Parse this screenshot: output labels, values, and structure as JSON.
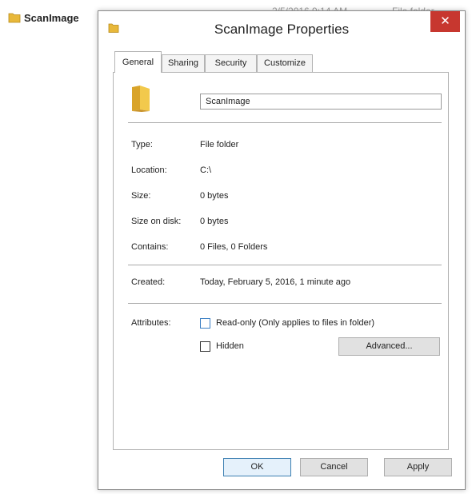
{
  "background": {
    "folder_name": "ScanImage",
    "date_fragment": "2/5/2016 9:14 AM",
    "type_fragment": "File folder"
  },
  "dialog": {
    "title": "ScanImage Properties",
    "close_glyph": "✕",
    "tabs": [
      {
        "label": "General",
        "active": true
      },
      {
        "label": "Sharing",
        "active": false
      },
      {
        "label": "Security",
        "active": false
      },
      {
        "label": "Customize",
        "active": false
      }
    ],
    "general": {
      "name_value": "ScanImage",
      "rows": [
        {
          "label": "Type:",
          "value": "File folder"
        },
        {
          "label": "Location:",
          "value": "C:\\"
        },
        {
          "label": "Size:",
          "value": "0 bytes"
        },
        {
          "label": "Size on disk:",
          "value": "0 bytes"
        },
        {
          "label": "Contains:",
          "value": "0 Files, 0 Folders"
        }
      ],
      "created_label": "Created:",
      "created_value": "Today, February 5, 2016, 1 minute ago",
      "attributes_label": "Attributes:",
      "readonly_label": "Read-only (Only applies to files in folder)",
      "hidden_label": "Hidden",
      "readonly_checked": false,
      "hidden_checked": false,
      "advanced_button": "Advanced..."
    },
    "buttons": {
      "ok": "OK",
      "cancel": "Cancel",
      "apply": "Apply"
    }
  },
  "colors": {
    "close_button": "#c7372f",
    "folder_yellow": "#e8b83a",
    "default_button_border": "#3c7fb1",
    "checkbox_blue": "#3b7fc4"
  },
  "icons": {
    "folder": "folder-icon",
    "close": "close-icon"
  }
}
